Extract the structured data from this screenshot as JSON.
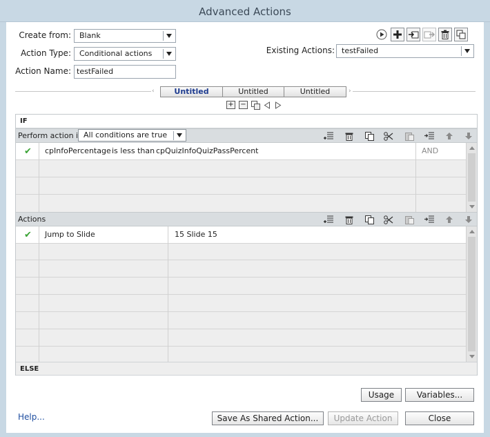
{
  "window": {
    "title": "Advanced Actions"
  },
  "form": {
    "create_from_label": "Create from:",
    "create_from_value": "Blank",
    "action_type_label": "Action Type:",
    "action_type_value": "Conditional actions",
    "action_name_label": "Action Name:",
    "action_name_value": "testFailed",
    "existing_actions_label": "Existing Actions:",
    "existing_actions_value": "testFailed"
  },
  "toolbar_icons": [
    "preview-icon",
    "add-icon",
    "import-icon",
    "export-icon",
    "delete-icon",
    "duplicate-icon"
  ],
  "tabs": [
    {
      "label": "Untitled",
      "active": true
    },
    {
      "label": "Untitled",
      "active": false
    },
    {
      "label": "Untitled",
      "active": false
    }
  ],
  "tab_controls": [
    "add-condition-icon",
    "remove-condition-icon",
    "copy-condition-icon",
    "prev-icon",
    "next-icon"
  ],
  "if_section": {
    "header": "IF",
    "perform_label": "Perform action if:",
    "perform_value": "All conditions are true",
    "conditions": [
      {
        "checked": true,
        "variable": "cpInfoPercentage",
        "operator": "is less than",
        "value": "cpQuizInfoQuizPassPercent",
        "conjunction": "AND"
      }
    ]
  },
  "actions_section": {
    "header": "Actions",
    "rows": [
      {
        "checked": true,
        "action": "Jump to Slide",
        "target": "15 Slide 15"
      }
    ]
  },
  "else_section": {
    "header": "ELSE"
  },
  "grid_toolbar_icons": [
    "insert-row-icon",
    "trash-icon",
    "copy-icon",
    "cut-icon",
    "paste-icon",
    "indent-icon",
    "move-up-icon",
    "move-down-icon"
  ],
  "footer": {
    "usage_label": "Usage",
    "variables_label": "Variables...",
    "help_label": "Help...",
    "save_shared_label": "Save As Shared Action...",
    "update_label": "Update Action",
    "close_label": "Close"
  }
}
